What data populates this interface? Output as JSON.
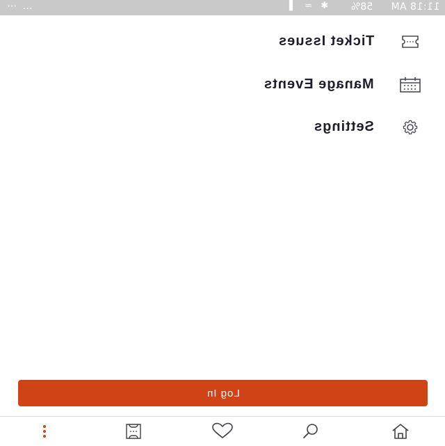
{
  "status_bar": {
    "time": "11:18 AM",
    "battery": "58%",
    "left_icons": "… ⋯",
    "right_icons": "✱ ≈ ▐"
  },
  "menu": {
    "items": [
      {
        "label": "Ticket Issues",
        "icon": "ticket-icon"
      },
      {
        "label": "Manage Events",
        "icon": "calendar-icon"
      },
      {
        "label": "Settings",
        "icon": "gear-icon"
      }
    ]
  },
  "login": {
    "label": "Log In"
  },
  "bottom_nav": {
    "items": [
      {
        "icon": "home-icon"
      },
      {
        "icon": "search-icon"
      },
      {
        "icon": "heart-icon"
      },
      {
        "icon": "ticket-icon"
      },
      {
        "icon": "more-icon"
      }
    ]
  },
  "colors": {
    "accent": "#cf4316",
    "status_bar": "#c9c9c9",
    "text": "#1e1e2a"
  }
}
